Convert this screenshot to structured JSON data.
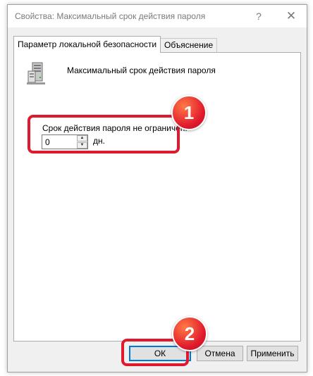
{
  "window": {
    "title": "Свойства: Максимальный срок действия пароля",
    "help_label": "?",
    "close_label": "✕"
  },
  "tabs": [
    {
      "label": "Параметр локальной безопасности",
      "active": true
    },
    {
      "label": "Объяснение",
      "active": false
    }
  ],
  "policy": {
    "title": "Максимальный срок действия пароля",
    "icon": "server-icon"
  },
  "setting": {
    "label": "Срок действия пароля не ограничен.",
    "value": "0",
    "unit": "дн."
  },
  "buttons": {
    "ok": "ОК",
    "cancel": "Отмена",
    "apply": "Применить"
  },
  "annotations": [
    {
      "number": "1"
    },
    {
      "number": "2"
    }
  ],
  "colors": {
    "highlight": "#e0192d",
    "focus_border": "#0078d7"
  }
}
